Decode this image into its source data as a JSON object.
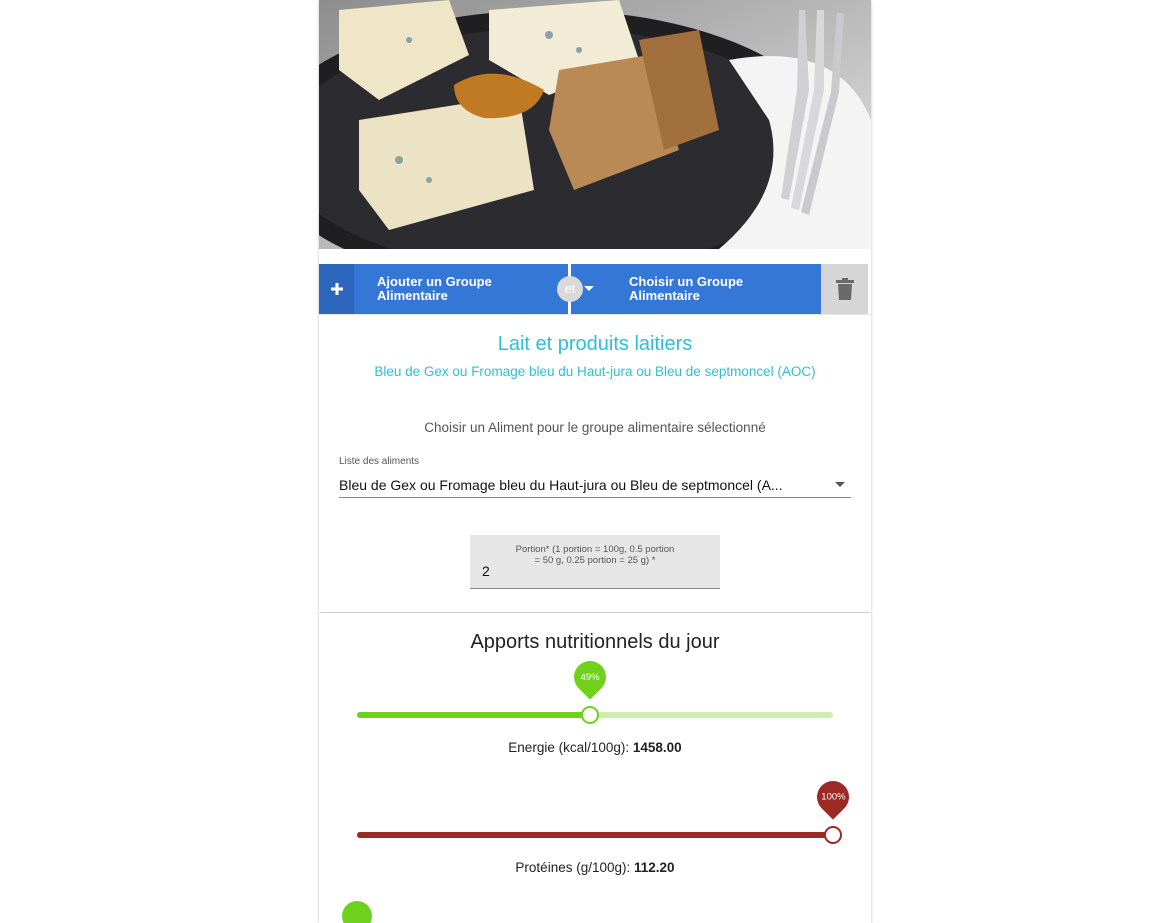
{
  "actions": {
    "add_label": "Ajouter un Groupe Alimentaire",
    "connector": "et",
    "choose_label": "Choisir un Groupe Alimentaire"
  },
  "group": {
    "title": "Lait et produits laitiers",
    "subtitle": "Bleu de Gex ou Fromage bleu du Haut-jura ou Bleu de septmoncel (AOC)"
  },
  "food_select": {
    "prompt": "Choisir un Aliment pour le groupe alimentaire sélectionné",
    "label": "Liste des aliments",
    "value": "Bleu de Gex ou Fromage bleu du Haut-jura ou Bleu de septmoncel (A..."
  },
  "portion": {
    "label_line1": "Portion* (1 portion = 100g, 0.5 portion",
    "label_line2": "= 50 g, 0.25 portion = 25 g) *",
    "value": "2"
  },
  "nutrition": {
    "title": "Apports nutritionnels du jour",
    "sliders": [
      {
        "percent": 49,
        "percent_label": "49%",
        "label": "Energie (kcal/100g):",
        "value": "1458.00",
        "color": "#6fd11c",
        "track_color": "#cdeeb0"
      },
      {
        "percent": 100,
        "percent_label": "100%",
        "label": "Protéines (g/100g):",
        "value": "112.20",
        "color": "#9b2a24",
        "track_color": "#9b2a24"
      }
    ]
  },
  "colors": {
    "primary": "#3577d6",
    "accent": "#2cbfd8"
  }
}
